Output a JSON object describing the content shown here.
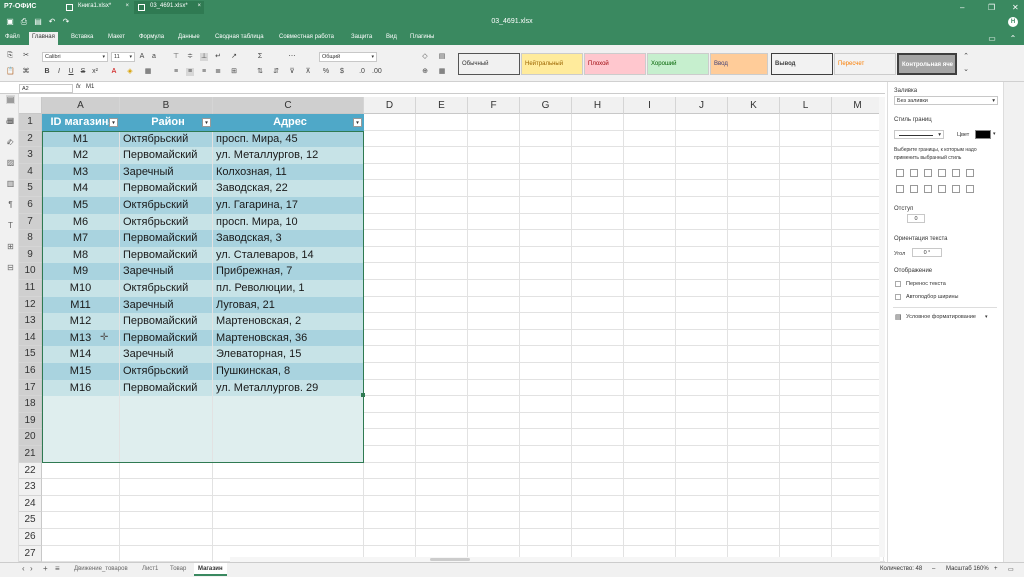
{
  "app": {
    "name": "Р7-ОФИС",
    "window_title": "03_4691.xlsx",
    "tabs": [
      {
        "label": "Книга1.xlsx*"
      },
      {
        "label": "03_4691.xlsx*"
      }
    ],
    "user_initial": "Н"
  },
  "menu": {
    "items": [
      "Файл",
      "Главная",
      "Вставка",
      "Макет",
      "Формула",
      "Данные",
      "Сводная таблица",
      "Совместная работа",
      "Защита",
      "Вид",
      "Плагины"
    ],
    "active": "Главная"
  },
  "toolbar": {
    "font": "Calibri",
    "font_size": "11",
    "number_format": "Общий"
  },
  "cell_styles": [
    {
      "label": "Обычный",
      "bg": "#ffffff",
      "fg": "#000000"
    },
    {
      "label": "Нейтральный",
      "bg": "#ffeb9c",
      "fg": "#9c6500"
    },
    {
      "label": "Плохой",
      "bg": "#ffc7ce",
      "fg": "#9c0006"
    },
    {
      "label": "Хороший",
      "bg": "#c6efce",
      "fg": "#006100"
    },
    {
      "label": "Ввод",
      "bg": "#ffcc99",
      "fg": "#3f3f76"
    },
    {
      "label": "Вывод",
      "bg": "#f2f2f2",
      "fg": "#3f3f3f"
    },
    {
      "label": "Пересчет",
      "bg": "#f2f2f2",
      "fg": "#fa7d00"
    },
    {
      "label": "Контрольная яче",
      "bg": "#a5a5a5",
      "fg": "#ffffff"
    }
  ],
  "formula_bar": {
    "name_box": "A2",
    "fx": "fx",
    "value": "M1"
  },
  "columns": [
    "A",
    "B",
    "C",
    "D",
    "E",
    "F",
    "G",
    "H",
    "I",
    "J",
    "K",
    "L",
    "M"
  ],
  "rows": [
    "1",
    "2",
    "3",
    "4",
    "5",
    "6",
    "7",
    "8",
    "9",
    "10",
    "11",
    "12",
    "13",
    "14",
    "15",
    "16",
    "17",
    "18",
    "19",
    "20",
    "21",
    "22",
    "23",
    "24",
    "25",
    "26",
    "27"
  ],
  "table": {
    "headers": [
      "ID магазина",
      "Район",
      "Адрес"
    ],
    "rows": [
      [
        "M1",
        "Октябрьский",
        "просп. Мира, 45"
      ],
      [
        "M2",
        "Первомайский",
        "ул. Металлургов, 12"
      ],
      [
        "M3",
        "Заречный",
        "Колхозная, 11"
      ],
      [
        "M4",
        "Первомайский",
        "Заводская, 22"
      ],
      [
        "M5",
        "Октябрьский",
        "ул. Гагарина, 17"
      ],
      [
        "M6",
        "Октябрьский",
        "просп. Мира, 10"
      ],
      [
        "M7",
        "Первомайский",
        "Заводская, 3"
      ],
      [
        "M8",
        "Первомайский",
        "ул. Сталеваров, 14"
      ],
      [
        "M9",
        "Заречный",
        "Прибрежная, 7"
      ],
      [
        "M10",
        "Октябрьский",
        "пл. Революции, 1"
      ],
      [
        "M11",
        "Заречный",
        "Луговая, 21"
      ],
      [
        "M12",
        "Первомайский",
        "Мартеновская, 2"
      ],
      [
        "M13",
        "Первомайский",
        "Мартеновская, 36"
      ],
      [
        "M14",
        "Заречный",
        "Элеваторная, 15"
      ],
      [
        "M15",
        "Октябрьский",
        "Пушкинская, 8"
      ],
      [
        "M16",
        "Первомайский",
        "ул. Металлургов. 29"
      ]
    ],
    "header_color": "#4fa8c8",
    "band_color_1": "#a9d3df",
    "band_color_2": "#c7e3e7"
  },
  "right_panel": {
    "fill_label": "Заливка",
    "fill_value": "Без заливки",
    "border_style_label": "Стиль границ",
    "color_label": "Цвет",
    "border_hint": "Выберите границы, к которым надо применить выбранный стиль",
    "indent_label": "Отступ",
    "indent_value": "0",
    "orientation_label": "Ориентация текста",
    "angle_label": "Угол",
    "angle_value": "0 °",
    "display_label": "Отображение",
    "wrap_label": "Перенос текста",
    "autofit_label": "Автоподбор ширины",
    "cond_format_label": "Условное форматирование"
  },
  "sheets": {
    "tabs": [
      "Движение_товаров",
      "Лист1",
      "Товар",
      "Магазин"
    ],
    "active": "Магазин"
  },
  "status": {
    "count": "Количество: 48",
    "zoom": "Масштаб 160%"
  }
}
